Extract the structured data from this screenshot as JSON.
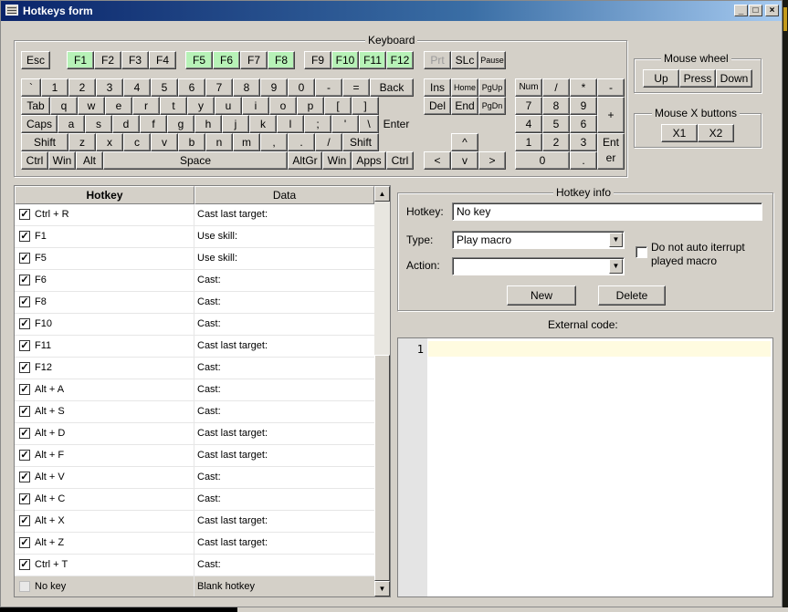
{
  "window": {
    "title": "Hotkeys form",
    "min_symbol": "_",
    "max_symbol": "□",
    "close_symbol": "×"
  },
  "keyboard": {
    "label": "Keyboard",
    "keys": {
      "esc": "Esc",
      "f1": "F1",
      "f2": "F2",
      "f3": "F3",
      "f4": "F4",
      "f5": "F5",
      "f6": "F6",
      "f7": "F7",
      "f8": "F8",
      "f9": "F9",
      "f10": "F10",
      "f11": "F11",
      "f12": "F12",
      "prt": "Prt",
      "slc": "SLc",
      "pause": "Pause",
      "grave": "`",
      "k1": "1",
      "k2": "2",
      "k3": "3",
      "k4": "4",
      "k5": "5",
      "k6": "6",
      "k7": "7",
      "k8": "8",
      "k9": "9",
      "k0": "0",
      "minus": "-",
      "equal": "=",
      "back": "Back",
      "tab": "Tab",
      "q": "q",
      "w": "w",
      "e": "e",
      "r": "r",
      "t": "t",
      "y": "y",
      "u": "u",
      "i": "i",
      "o": "o",
      "p": "p",
      "lbr": "[",
      "rbr": "]",
      "caps": "Caps",
      "a": "a",
      "s": "s",
      "d": "d",
      "f": "f",
      "g": "g",
      "h": "h",
      "j": "j",
      "k": "k",
      "l": "l",
      "semi": ";",
      "quote": "'",
      "bslash": "\\",
      "enter": "Enter",
      "lshift": "Shift",
      "z": "z",
      "x": "x",
      "c": "c",
      "v": "v",
      "b": "b",
      "n": "n",
      "m": "m",
      "comma": ",",
      "dot": ".",
      "slash": "/",
      "rshift": "Shift",
      "lctrl": "Ctrl",
      "lwin": "Win",
      "lalt": "Alt",
      "space": "Space",
      "altgr": "AltGr",
      "rwin": "Win",
      "apps": "Apps",
      "rctrl": "Ctrl",
      "ins": "Ins",
      "home": "Home",
      "pgup": "PgUp",
      "del": "Del",
      "end": "End",
      "pgdn": "PgDn",
      "up": "^",
      "left": "<",
      "down": "v",
      "right": ">",
      "num": "Num",
      "ndiv": "/",
      "nmul": "*",
      "nsub": "-",
      "n7": "7",
      "n8": "8",
      "n9": "9",
      "nadd": "+",
      "n4": "4",
      "n5": "5",
      "n6": "6",
      "n1": "1",
      "n2": "2",
      "n3": "3",
      "nenter1": "Ent",
      "nenter2": "er",
      "n0": "0",
      "ndot": "."
    }
  },
  "mouse_wheel": {
    "label": "Mouse wheel",
    "up": "Up",
    "press": "Press",
    "down": "Down"
  },
  "mouse_x": {
    "label": "Mouse X buttons",
    "x1": "X1",
    "x2": "X2"
  },
  "hotkey_grid": {
    "col_hotkey": "Hotkey",
    "col_data": "Data",
    "rows": [
      {
        "hotkey": "Ctrl + R",
        "data": "Cast last target:",
        "checked": true
      },
      {
        "hotkey": "F1",
        "data": "Use skill:",
        "checked": true
      },
      {
        "hotkey": "F5",
        "data": "Use skill:",
        "checked": true
      },
      {
        "hotkey": "F6",
        "data": "Cast:",
        "checked": true
      },
      {
        "hotkey": "F8",
        "data": "Cast:",
        "checked": true
      },
      {
        "hotkey": "F10",
        "data": "Cast:",
        "checked": true
      },
      {
        "hotkey": "F11",
        "data": "Cast last target:",
        "checked": true
      },
      {
        "hotkey": "F12",
        "data": "Cast:",
        "checked": true
      },
      {
        "hotkey": "Alt + A",
        "data": "Cast:",
        "checked": true
      },
      {
        "hotkey": "Alt + S",
        "data": "Cast:",
        "checked": true
      },
      {
        "hotkey": "Alt + D",
        "data": "Cast last target:",
        "checked": true
      },
      {
        "hotkey": "Alt + F",
        "data": "Cast last target:",
        "checked": true
      },
      {
        "hotkey": "Alt + V",
        "data": "Cast:",
        "checked": true
      },
      {
        "hotkey": "Alt + C",
        "data": "Cast:",
        "checked": true
      },
      {
        "hotkey": "Alt + X",
        "data": "Cast last target:",
        "checked": true
      },
      {
        "hotkey": "Alt + Z",
        "data": "Cast last target:",
        "checked": true
      },
      {
        "hotkey": "Ctrl + T",
        "data": "Cast:",
        "checked": true
      },
      {
        "hotkey": "No key",
        "data": "Blank hotkey",
        "checked": false
      }
    ]
  },
  "hotkey_info": {
    "label": "Hotkey info",
    "hotkey_label": "Hotkey:",
    "hotkey_value": "No key",
    "type_label": "Type:",
    "type_value": "Play macro",
    "action_label": "Action:",
    "action_value": "",
    "no_interrupt_label_1": "Do not auto iterrupt",
    "no_interrupt_label_2": "played macro",
    "new_label": "New",
    "delete_label": "Delete"
  },
  "external_code": {
    "label": "External code:",
    "line_number": "1"
  },
  "colors": {
    "key_active": "#b7f2b7",
    "face": "#d4d0c8",
    "title_start": "#0a246a"
  }
}
